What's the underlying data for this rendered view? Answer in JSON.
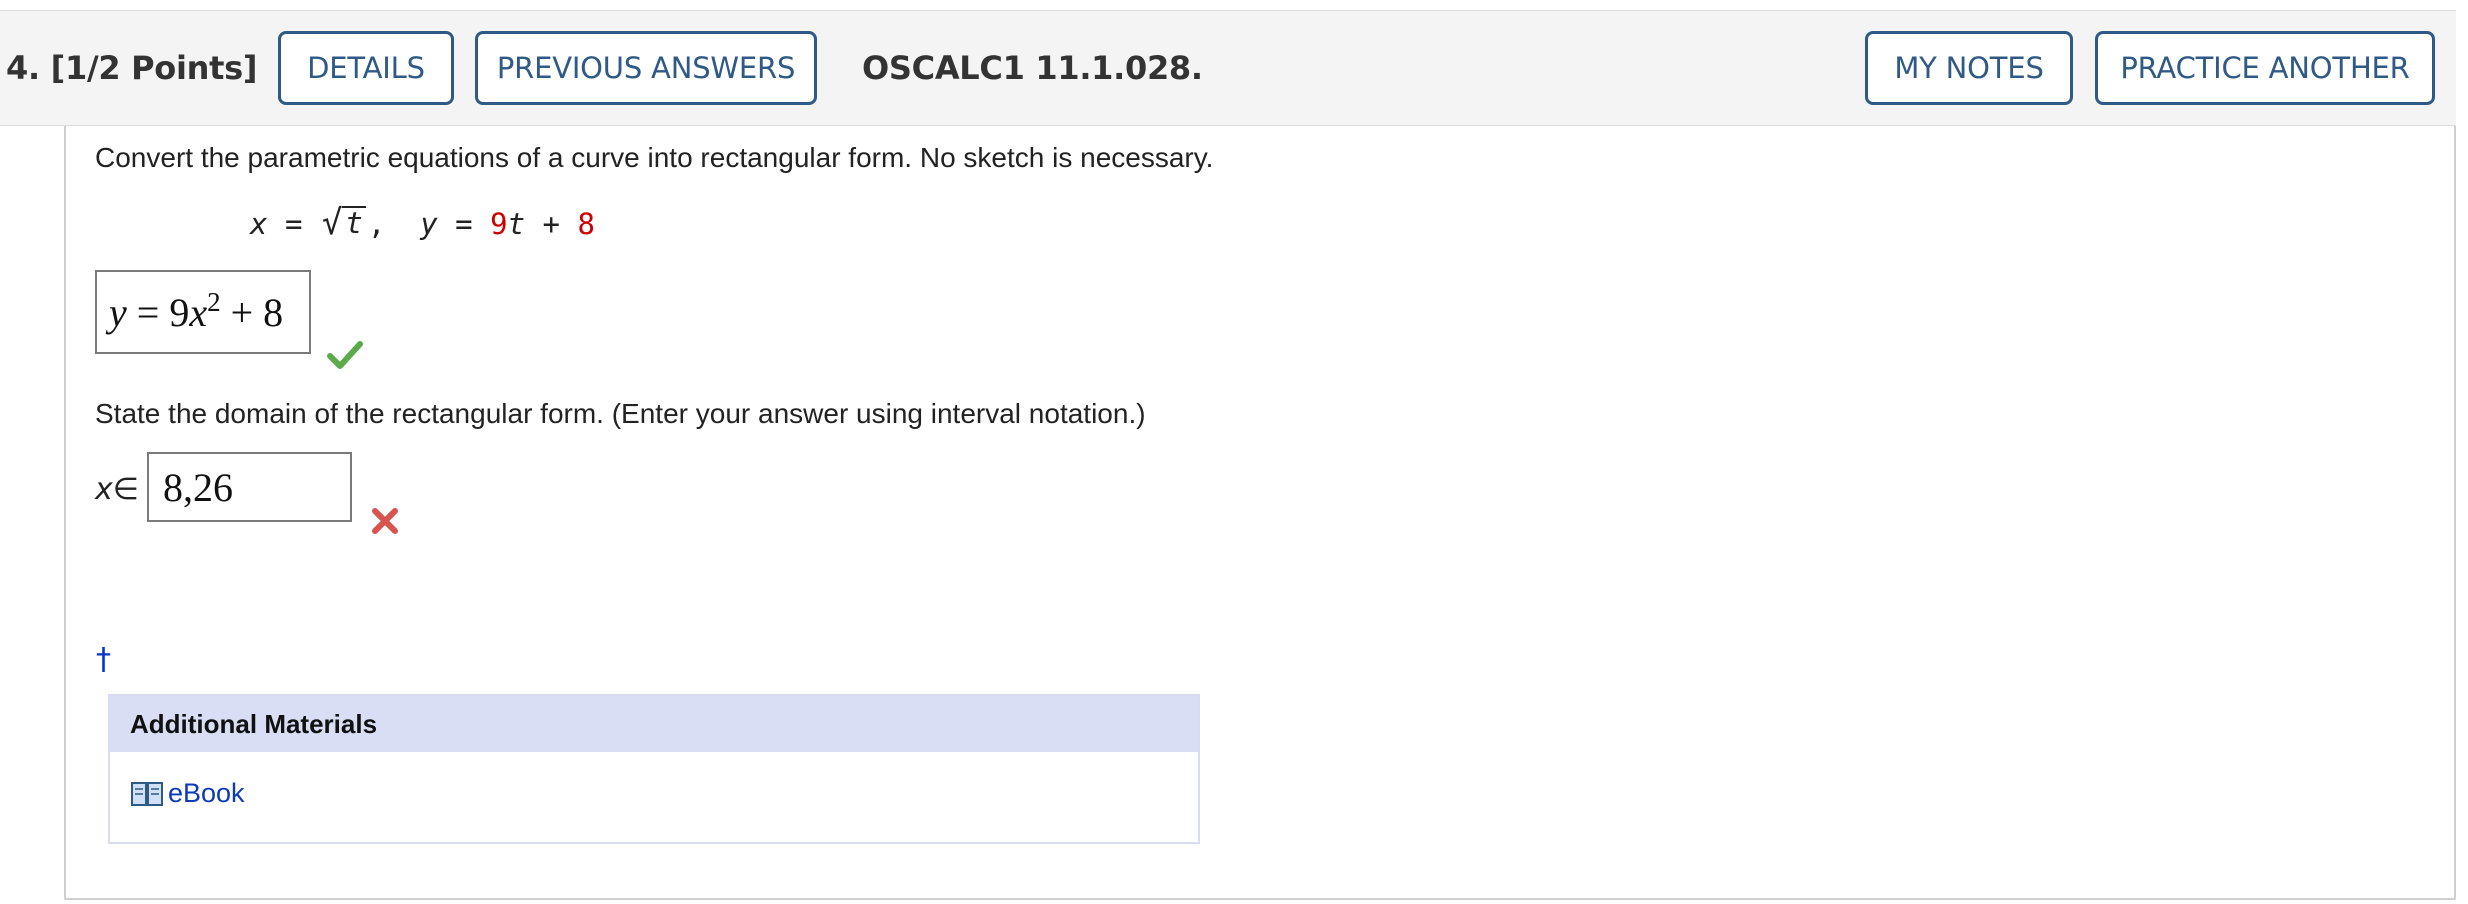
{
  "header": {
    "question_number": "4.",
    "points": "[1/2 Points]",
    "details_label": "DETAILS",
    "previous_answers_label": "PREVIOUS ANSWERS",
    "problem_id": "OSCALC1 11.1.028.",
    "my_notes_label": "MY NOTES",
    "practice_another_label": "PRACTICE ANOTHER"
  },
  "question": {
    "prompt": "Convert the parametric equations of a curve into rectangular form. No sketch is necessary.",
    "equation": {
      "x_var": "x",
      "equals": "=",
      "radicand": "t",
      "separator": ",",
      "y_var": "y",
      "coef": "9",
      "t_var": "t",
      "plus": "+",
      "const": "8"
    },
    "answer1": {
      "y": "y",
      "eq": "=",
      "coef": "9",
      "x": "x",
      "exp": "2",
      "rest": "+ 8",
      "status": "correct"
    },
    "domain_prompt": "State the domain of the rectangular form. (Enter your answer using interval notation.)",
    "domain_var": "x",
    "domain_symbol": "∈",
    "domain_answer": "8,26",
    "domain_status": "incorrect",
    "footnote_marker": "†"
  },
  "materials": {
    "title": "Additional Materials",
    "items": [
      {
        "label": "eBook",
        "icon": "book-icon"
      }
    ]
  },
  "colors": {
    "button_border": "#2f5a86",
    "highlight_red": "#cc0000",
    "correct_green": "#5cab4a",
    "incorrect_red": "#d9534f",
    "link_blue": "#0b39b8",
    "materials_header_bg": "#d9def5"
  }
}
